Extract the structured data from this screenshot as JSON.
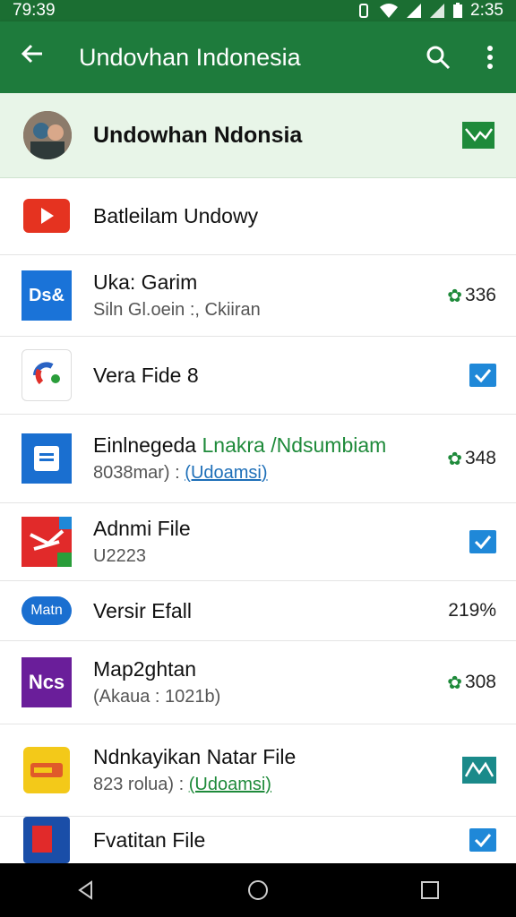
{
  "status_bar": {
    "time": "79:39",
    "clock_right": "2:35"
  },
  "app_bar": {
    "title": "Undovhan Indonesia"
  },
  "header": {
    "title": "Undowhan Ndonsia"
  },
  "items": [
    {
      "title": "Batleilam Undowy",
      "subtitle": "",
      "right": ""
    },
    {
      "title": "Uka: Garim",
      "subtitle": "Siln Gl.oein :, Ckiiran",
      "right": "336"
    },
    {
      "title": "Vera Fide 8",
      "subtitle": "",
      "right": ""
    },
    {
      "title": "Einlnegeda",
      "title_accent": "Lnakra /Ndsumbiam",
      "subtitle": "8038mar) :",
      "subtitle_link": "(Udoamsi)",
      "right": "348"
    },
    {
      "title": "Adnmi File",
      "subtitle": "U2223",
      "right": ""
    },
    {
      "title": "Versir Efall",
      "subtitle": "",
      "icon_label": "Matn",
      "right": "219%"
    },
    {
      "title": "Map2ghtan",
      "subtitle": "(Akaua : 1021b)",
      "icon_label": "Ncs",
      "right": "308"
    },
    {
      "title": "Ndnkayikan Natar File",
      "subtitle": "823 rolua) :",
      "subtitle_link": "(Udoamsi)",
      "right": ""
    },
    {
      "title": "Fvatitan File",
      "subtitle": "",
      "right": ""
    }
  ],
  "icons": {
    "youtube": "play-icon",
    "ds": "Ds&",
    "colors": {
      "appbar": "#1e7b3c",
      "header": "#e8f5e8",
      "accent_blue": "#1f88d8",
      "accent_green": "#1e8a3a"
    }
  }
}
